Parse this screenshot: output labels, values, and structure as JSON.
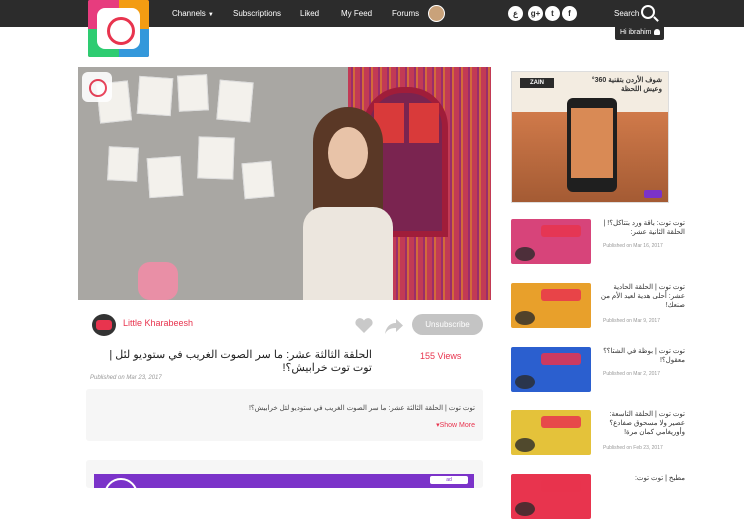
{
  "topbar": {
    "nav": [
      {
        "label": "Channels",
        "has_caret": true
      },
      {
        "label": "Subscriptions"
      },
      {
        "label": "Liked"
      },
      {
        "label": "My Feed"
      },
      {
        "label": "Forums"
      }
    ],
    "social_glyphs": [
      "ع",
      "g+",
      "t",
      "f"
    ],
    "search_label": "Search",
    "greeting": "Hi ibrahim"
  },
  "video": {
    "channel_name": "Little Kharabeesh",
    "unsubscribe_label": "Unsubscribe",
    "views": "155 Views",
    "title": "الحلقة الثالثة عشر: ما سر الصوت الغريب في ستوديو لئل | توت توت خرابيش؟!",
    "published": "Published on Mar 23, 2017",
    "description": "توت توت | الحلقة الثالثة عشر: ما سر الصوت الغريب في ستوديو لئل خرابيش؟!",
    "show_more": "Show More"
  },
  "ad": {
    "brand": "ZAIN",
    "text": "شوف الأردن بتقنية 360° وعيش اللحظة",
    "mini_ad_label": "ad"
  },
  "related": [
    {
      "title": "توت توت: باقة ورد بتتاكل؟! | الحلقة الثانية عشر:",
      "date": "Published on Mar 16, 2017",
      "thumb_color": "#d7447a"
    },
    {
      "title": "توت توت | الحلقة الحادية عشر: أحلى هدية لعيد الأم من صنعك!",
      "date": "Published on Mar 9, 2017",
      "thumb_color": "#e8a02b"
    },
    {
      "title": "توت توت | بوظة في الشتا؟؟ معقول؟!",
      "date": "Published on Mar 2, 2017",
      "thumb_color": "#2b5fcf"
    },
    {
      "title": "توت توت | الحلقة التاسعة: عصير ولا مسحوق صفادع؟ وأوريغامي كمان مرة!",
      "date": "Published on Feb 23, 2017",
      "thumb_color": "#e4c23a"
    },
    {
      "title": "مطبخ | توت توت:",
      "date": "",
      "thumb_color": "#e8344e"
    }
  ]
}
